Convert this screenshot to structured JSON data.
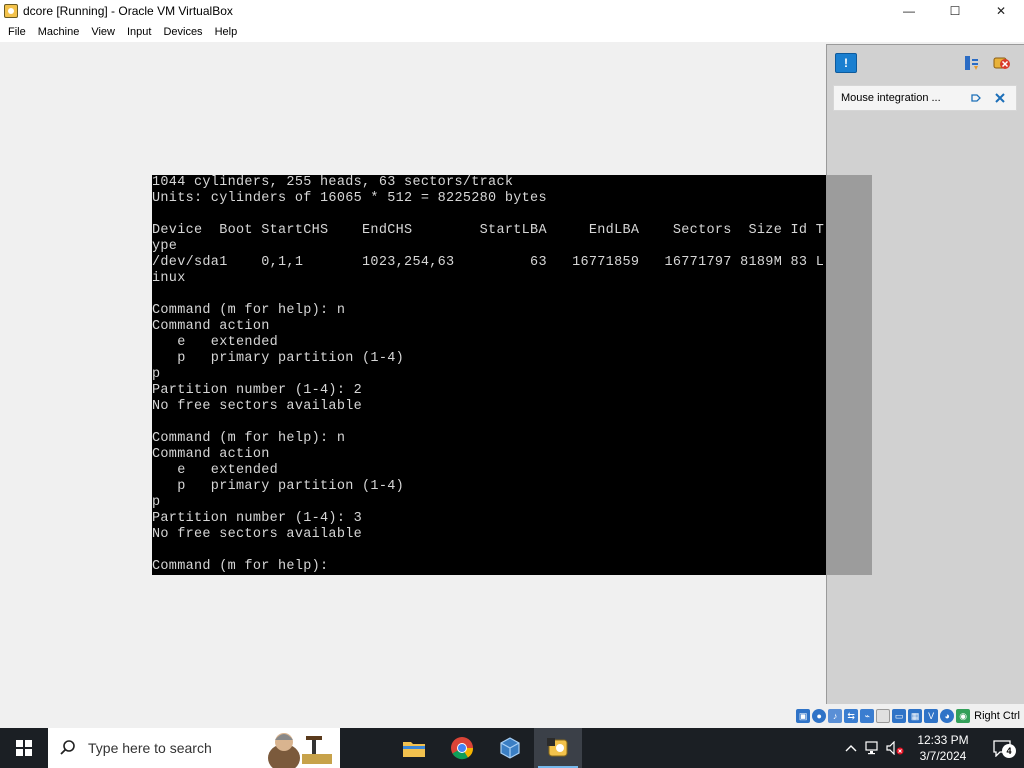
{
  "window": {
    "title": "dcore [Running] - Oracle VM VirtualBox",
    "minimize_glyph": "—",
    "maximize_glyph": "☐",
    "close_glyph": "✕"
  },
  "menu": {
    "items": [
      "File",
      "Machine",
      "View",
      "Input",
      "Devices",
      "Help"
    ]
  },
  "console": {
    "lines": [
      "1044 cylinders, 255 heads, 63 sectors/track",
      "Units: cylinders of 16065 * 512 = 8225280 bytes",
      "",
      "Device  Boot StartCHS    EndCHS        StartLBA     EndLBA    Sectors  Size Id T",
      "ype",
      "/dev/sda1    0,1,1       1023,254,63         63   16771859   16771797 8189M 83 L",
      "inux",
      "",
      "Command (m for help): n",
      "Command action",
      "   e   extended",
      "   p   primary partition (1-4)",
      "p",
      "Partition number (1-4): 2",
      "No free sectors available",
      "",
      "Command (m for help): n",
      "Command action",
      "   e   extended",
      "   p   primary partition (1-4)",
      "p",
      "Partition number (1-4): 3",
      "No free sectors available",
      "",
      "Command (m for help):"
    ]
  },
  "side_pane": {
    "message": "Mouse integration ...",
    "icons": [
      "notification-center-icon",
      "arrange-icon",
      "close-all-icon",
      "pin-icon",
      "dismiss-icon"
    ]
  },
  "statusbar": {
    "host_key": "Right Ctrl",
    "icons": [
      "hard-disk-icon",
      "optical-drive-icon",
      "audio-icon",
      "network-icon",
      "usb-icon",
      "shared-folders-icon",
      "display-icon",
      "recording-icon",
      "cpu-icon",
      "mouse-icon",
      "keyboard-icon"
    ]
  },
  "taskbar": {
    "search_placeholder": "Type here to search",
    "apps": [
      "file-explorer-icon",
      "chrome-icon",
      "virtualbox-icon",
      "vm-window-icon"
    ],
    "time": "12:33 PM",
    "date": "3/7/2024",
    "notification_count": "4"
  }
}
